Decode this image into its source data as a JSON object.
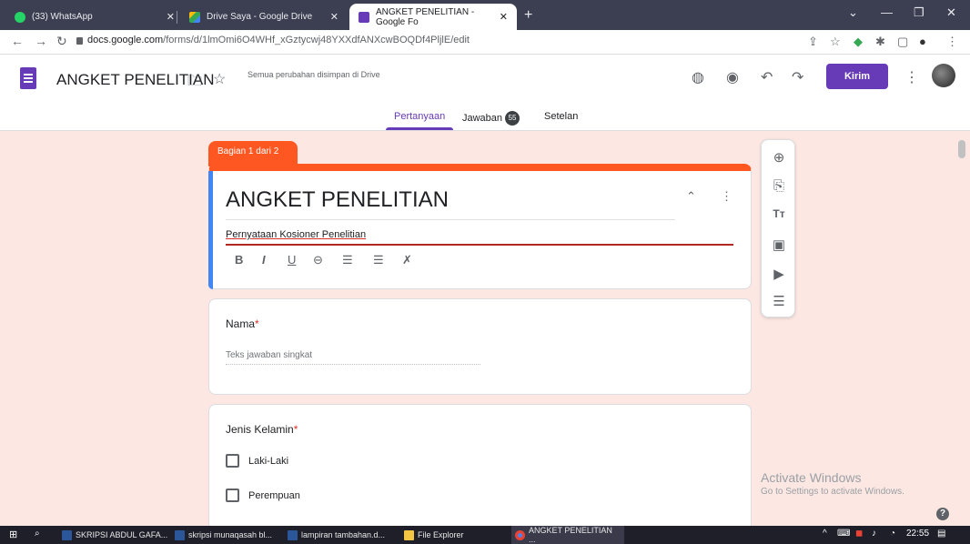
{
  "browser": {
    "tabs": [
      {
        "label": "(33) WhatsApp",
        "active": false,
        "color": "#25d366"
      },
      {
        "label": "Drive Saya - Google Drive",
        "active": false,
        "color": "#fbbc04"
      },
      {
        "label": "ANGKET PENELITIAN - Google Fo",
        "active": true,
        "color": "#673ab7"
      }
    ],
    "url_host": "docs.google.com",
    "url_path": "/forms/d/1lmOmi6O4WHf_xGztycwj48YXXdfANXcwBOQDf4PljlE/edit"
  },
  "header": {
    "form_title": "ANGKET PENELITIAN",
    "save_status": "Semua perubahan disimpan di Drive",
    "send_label": "Kirim",
    "tabs": {
      "questions": "Pertanyaan",
      "responses": "Jawaban",
      "responses_count": "55",
      "settings": "Setelan"
    }
  },
  "section": {
    "label": "Bagian 1 dari 2"
  },
  "title_card": {
    "title": "ANGKET PENELITIAN",
    "description": "Pernyataan Kosioner Penelitian",
    "collapse_icon": "collapse-icon",
    "more_icon": "more-vert-icon"
  },
  "questions": [
    {
      "title": "Nama",
      "required": "*",
      "placeholder": "Teks jawaban singkat"
    },
    {
      "title": "Jenis Kelamin",
      "required": "*",
      "options": [
        "Laki-Laki",
        "Perempuan"
      ]
    }
  ],
  "watermark": {
    "line1": "Activate Windows",
    "line2": "Go to Settings to activate Windows."
  },
  "taskbar": {
    "items": [
      "SKRIPSI ABDUL GAFA...",
      "skripsi munaqasah bl...",
      "lampiran tambahan.d...",
      "File Explorer",
      "ANGKET PENELITIAN ..."
    ],
    "time": "22:55"
  },
  "colors": {
    "accent": "#673ab7",
    "section": "#ff5722",
    "background": "#fce7e2"
  }
}
